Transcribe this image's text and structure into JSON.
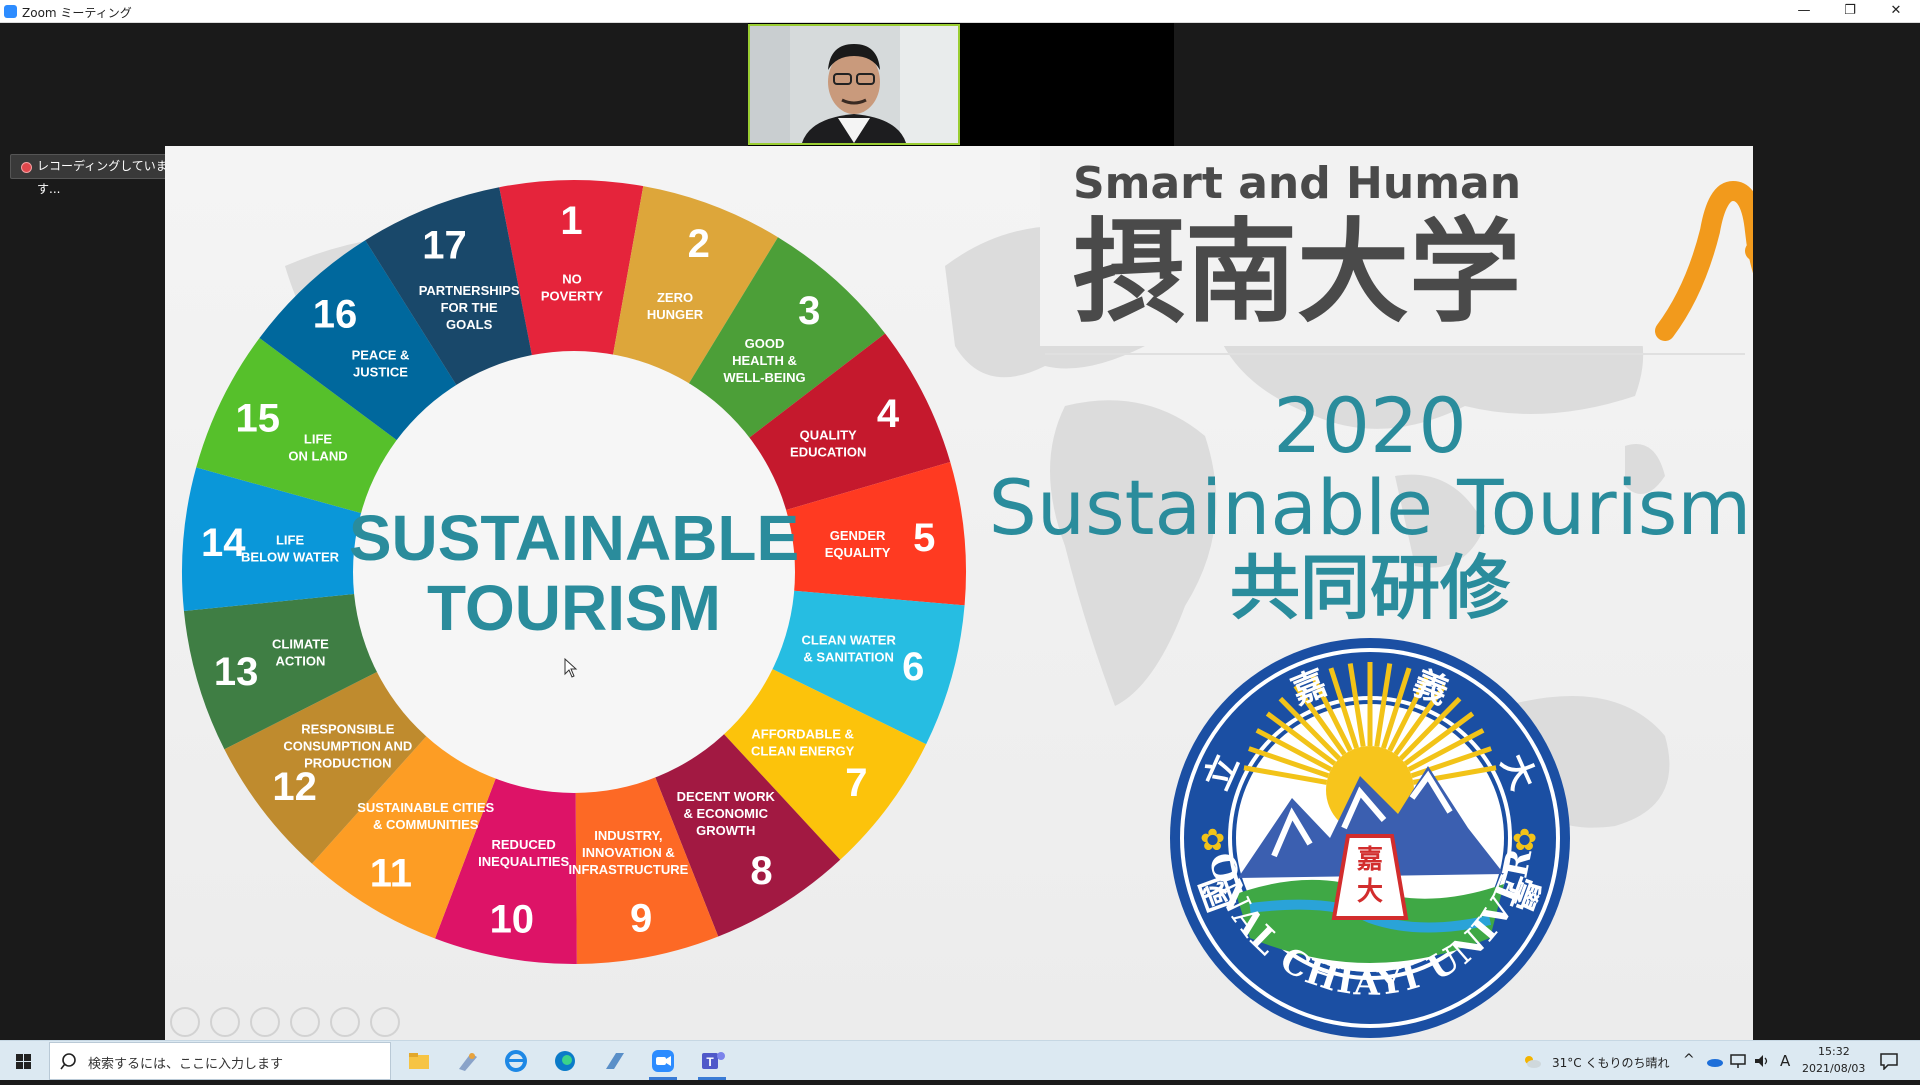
{
  "window": {
    "title": "Zoom ミーティング",
    "minimize": "—",
    "restore": "❐",
    "close": "✕"
  },
  "recording": {
    "label": "レコーディングしています..."
  },
  "slide": {
    "wheel_title_line1": "SUSTAINABLE",
    "wheel_title_line2": "TOURISM",
    "brand_tagline": "Smart and Human",
    "brand_name": "摂南大学",
    "year": "2020",
    "event_title": "Sustainable Tourism",
    "event_subtitle": "共同研修",
    "seal": {
      "top_chars": [
        "國",
        "立",
        "嘉",
        "義",
        "大",
        "學"
      ],
      "bottom_text": "NATIONAL CHIAYI UNIVERSITY",
      "center_chars": [
        "嘉",
        "大"
      ]
    },
    "sdgs": [
      {
        "n": "1",
        "label": [
          "NO",
          "POVERTY"
        ],
        "color": "#e5243b"
      },
      {
        "n": "2",
        "label": [
          "ZERO",
          "HUNGER"
        ],
        "color": "#dda63a"
      },
      {
        "n": "3",
        "label": [
          "GOOD",
          "HEALTH &",
          "WELL-BEING"
        ],
        "color": "#4c9f38"
      },
      {
        "n": "4",
        "label": [
          "QUALITY",
          "EDUCATION"
        ],
        "color": "#c5192d"
      },
      {
        "n": "5",
        "label": [
          "GENDER",
          "EQUALITY"
        ],
        "color": "#ff3a21"
      },
      {
        "n": "6",
        "label": [
          "CLEAN WATER",
          "& SANITATION"
        ],
        "color": "#26bde2"
      },
      {
        "n": "7",
        "label": [
          "AFFORDABLE &",
          "CLEAN ENERGY"
        ],
        "color": "#fcc30b"
      },
      {
        "n": "8",
        "label": [
          "DECENT WORK",
          "& ECONOMIC",
          "GROWTH"
        ],
        "color": "#a21942"
      },
      {
        "n": "9",
        "label": [
          "INDUSTRY,",
          "INNOVATION &",
          "INFRASTRUCTURE"
        ],
        "color": "#fd6925"
      },
      {
        "n": "10",
        "label": [
          "REDUCED",
          "INEQUALITIES"
        ],
        "color": "#dd1367"
      },
      {
        "n": "11",
        "label": [
          "SUSTAINABLE CITIES",
          "& COMMUNITIES"
        ],
        "color": "#fd9d24"
      },
      {
        "n": "12",
        "label": [
          "RESPONSIBLE",
          "CONSUMPTION AND",
          "PRODUCTION"
        ],
        "color": "#bf8b2e"
      },
      {
        "n": "13",
        "label": [
          "CLIMATE",
          "ACTION"
        ],
        "color": "#3f7e44"
      },
      {
        "n": "14",
        "label": [
          "LIFE",
          "BELOW WATER"
        ],
        "color": "#0a97d9"
      },
      {
        "n": "15",
        "label": [
          "LIFE",
          "ON LAND"
        ],
        "color": "#56c02b"
      },
      {
        "n": "16",
        "label": [
          "PEACE &",
          "JUSTICE"
        ],
        "color": "#00689d"
      },
      {
        "n": "17",
        "label": [
          "PARTNERSHIPS",
          "FOR THE",
          "GOALS"
        ],
        "color": "#19486a"
      }
    ],
    "colors": {
      "teal": "#2a8c9c",
      "orange": "#f29a1c",
      "brand_gray": "#4a4a4a"
    }
  },
  "taskbar": {
    "search_placeholder": "検索するには、ここに入力します",
    "apps": [
      "file-explorer-icon",
      "pinned-app-icon",
      "internet-explorer-icon",
      "edge-icon",
      "notepad-icon",
      "zoom-icon",
      "teams-icon"
    ],
    "weather": "31°C  くもりのち晴れ",
    "ime": "A",
    "time": "15:32",
    "date": "2021/08/03"
  }
}
